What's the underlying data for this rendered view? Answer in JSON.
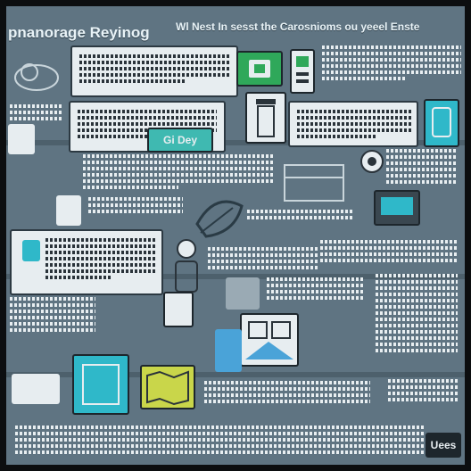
{
  "header": {
    "left_title": "pnanorage Reyinog",
    "right_title": "Wl Nest In sesst the Carosnioms ou yeeel Enste"
  },
  "badge_text": "Gi Dey",
  "footer_logo_text": "Uees",
  "colors": {
    "background": "#5f7482",
    "panel_light": "#e7edf0",
    "panel_dark": "#3a4750",
    "accent_green": "#2fa85a",
    "accent_teal": "#2fb8c9",
    "accent_yellow": "#c9d64a",
    "accent_blue": "#4aa3d8"
  },
  "icons": [
    "device-icon",
    "lock-icon",
    "bottle-icon",
    "gear-icon",
    "leaf-icon",
    "box-icon",
    "person-icon",
    "map-icon"
  ]
}
